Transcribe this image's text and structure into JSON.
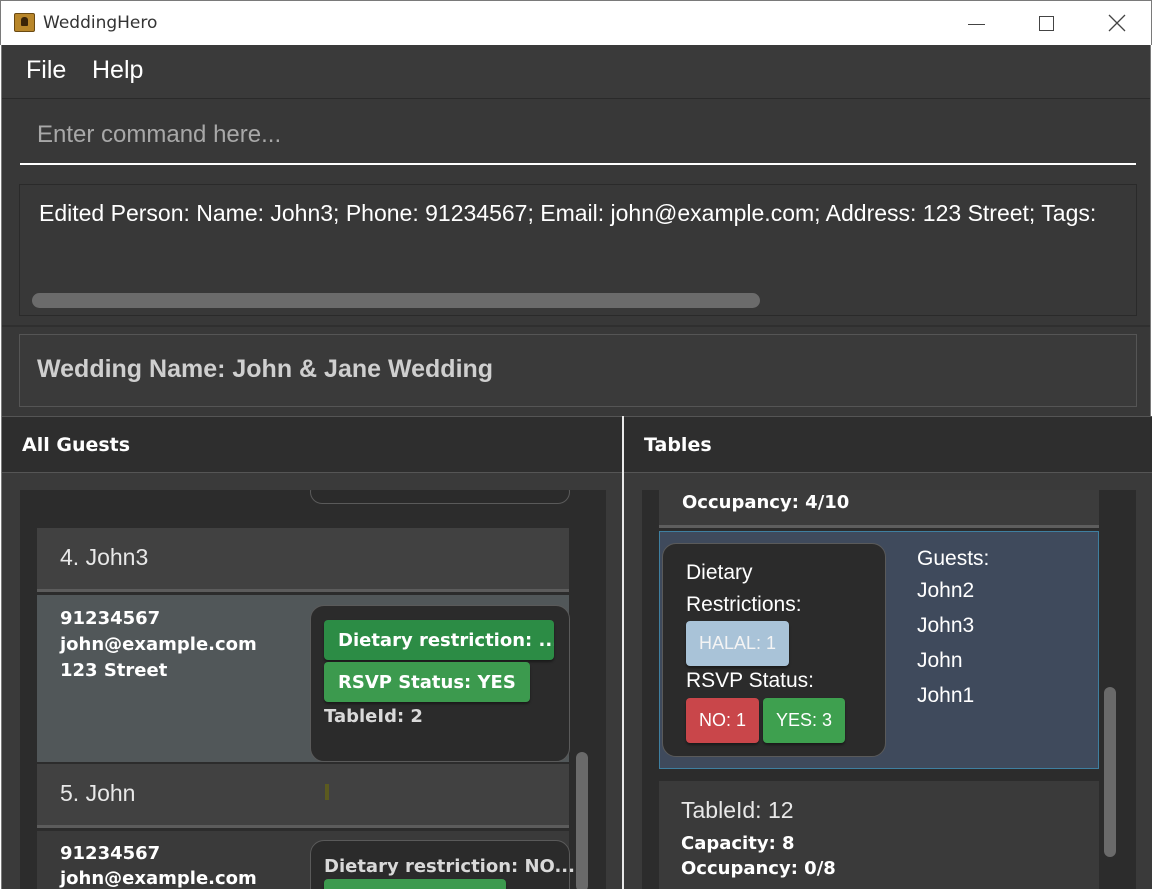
{
  "window": {
    "title": "WeddingHero"
  },
  "menu": {
    "file": "File",
    "help": "Help"
  },
  "command": {
    "placeholder": "Enter command here..."
  },
  "result": {
    "text": "Edited Person: Name: John3; Phone: 91234567; Email: john@example.com; Address: 123 Street; Tags:"
  },
  "wedding": {
    "label": "Wedding Name: John & Jane Wedding"
  },
  "guests_panel": {
    "title": "All Guests",
    "guests": [
      {
        "name": "4. John3",
        "phone": "91234567",
        "email": "john@example.com",
        "address": "123 Street",
        "dietary_tag": "Dietary restriction: ...",
        "rsvp_tag": "RSVP Status: YES",
        "table_id": "TableId: 2"
      },
      {
        "name": "5. John",
        "phone": "91234567",
        "email": "john@example.com",
        "dietary_text": "Dietary restriction: NO..."
      }
    ]
  },
  "tables_panel": {
    "title": "Tables",
    "top_occupancy": "Occupancy: 4/10",
    "selected_table": {
      "dietary_label_1": "Dietary",
      "dietary_label_2": "Restrictions:",
      "halal_chip": "HALAL: 1",
      "rsvp_label": "RSVP Status:",
      "no_chip": "NO: 1",
      "yes_chip": "YES: 3",
      "guests_label": "Guests:",
      "guest_names": [
        "John2",
        "John3",
        "John",
        "John1"
      ]
    },
    "next_table": {
      "title": "TableId: 12",
      "capacity": "Capacity: 8",
      "occupancy": "Occupancy: 0/8"
    }
  },
  "colors": {
    "background": "#383838",
    "tag_green": "#3c9a4e",
    "chip_red": "#c9464a",
    "chip_halal": "#a9c3d8",
    "selected_table_bg": "#3f4a5c"
  }
}
